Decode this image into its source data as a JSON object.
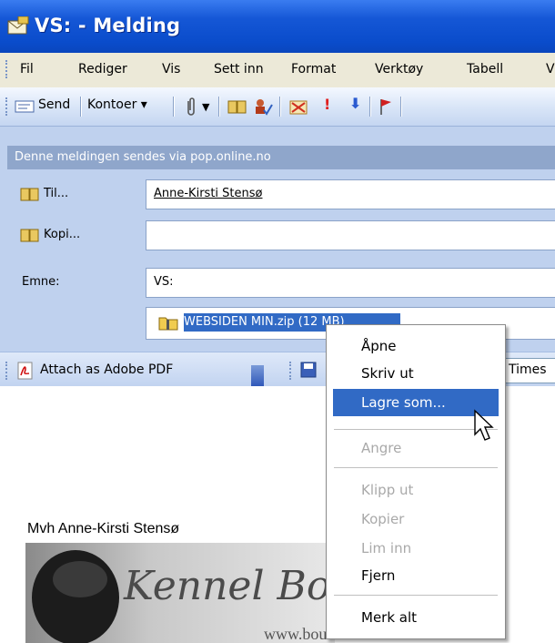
{
  "window": {
    "title": "VS:  - Melding"
  },
  "menu": [
    "Fil",
    "Rediger",
    "Vis",
    "Sett inn",
    "Format",
    "Verktøy",
    "Tabell",
    "V"
  ],
  "toolbar": {
    "send": "Send",
    "accounts": "Kontoer ▾"
  },
  "info": "Denne meldingen sendes via pop.online.no",
  "fields": {
    "to_label": "Til...",
    "to_value": "Anne-Kirsti Stensø",
    "cc_label": "Kopi...",
    "cc_value": "",
    "subject_label": "Emne:",
    "subject_value": "VS:",
    "attachment": "WEBSIDEN MIN.zip (12 MB)"
  },
  "attach_bar": {
    "adobe": "Attach as Adobe PDF",
    "font": "Times"
  },
  "body": {
    "signature": "Mvh Anne-Kirsti Stensø",
    "banner_text": "Kennel Bo",
    "url_fragment": "www.bouvier.com"
  },
  "context_menu": [
    "Åpne",
    "Skriv ut",
    "Lagre som...",
    "Angre",
    "Klipp ut",
    "Kopier",
    "Lim inn",
    "Fjern",
    "Merk alt"
  ],
  "colors": {
    "title": "#0a4ccb",
    "header": "#bfd1ee",
    "highlight": "#316ac5"
  }
}
